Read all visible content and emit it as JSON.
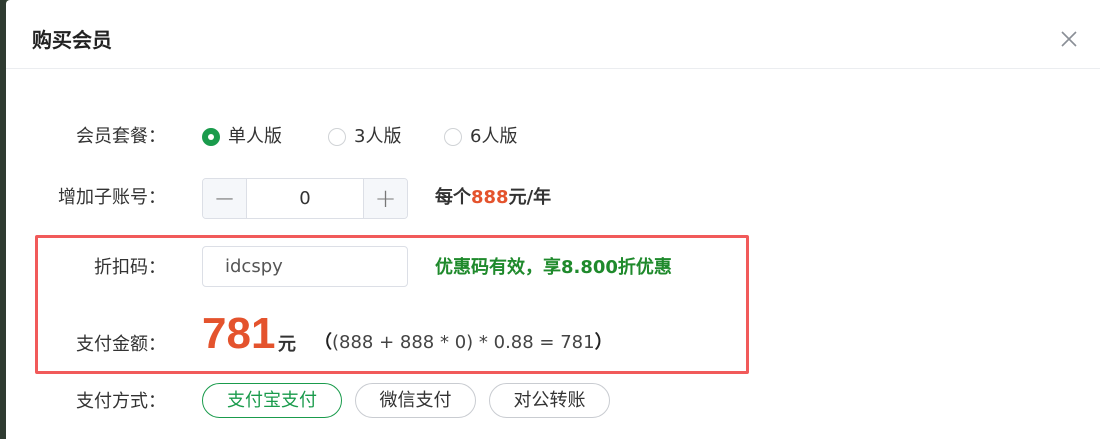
{
  "modal": {
    "title": "购买会员"
  },
  "membership": {
    "label": "会员套餐：",
    "options": [
      {
        "label": "单人版",
        "checked": true
      },
      {
        "label": "3人版",
        "checked": false
      },
      {
        "label": "6人版",
        "checked": false
      }
    ]
  },
  "subaccount": {
    "label": "增加子账号：",
    "value": "0",
    "minus": "−",
    "plus": "+",
    "note_prefix": "每个",
    "note_price": "888",
    "note_suffix": "元/年"
  },
  "discount": {
    "label": "折扣码：",
    "value": "idcspy",
    "status": "优惠码有效，享8.800折优惠"
  },
  "payment_amount": {
    "label": "支付金额：",
    "amount": "781",
    "unit": "元",
    "formula_open": "（",
    "formula": "(888 + 888 * 0) * 0.88 = 781",
    "formula_close": "）"
  },
  "payment_method": {
    "label": "支付方式：",
    "options": [
      {
        "label": "支付宝支付",
        "active": true
      },
      {
        "label": "微信支付",
        "active": false
      },
      {
        "label": "对公转账",
        "active": false
      }
    ]
  },
  "colors": {
    "accent_green": "#1a9b4c",
    "price_red": "#e4532d",
    "highlight_border": "#f15a5a",
    "success_green": "#1f8a2c"
  }
}
